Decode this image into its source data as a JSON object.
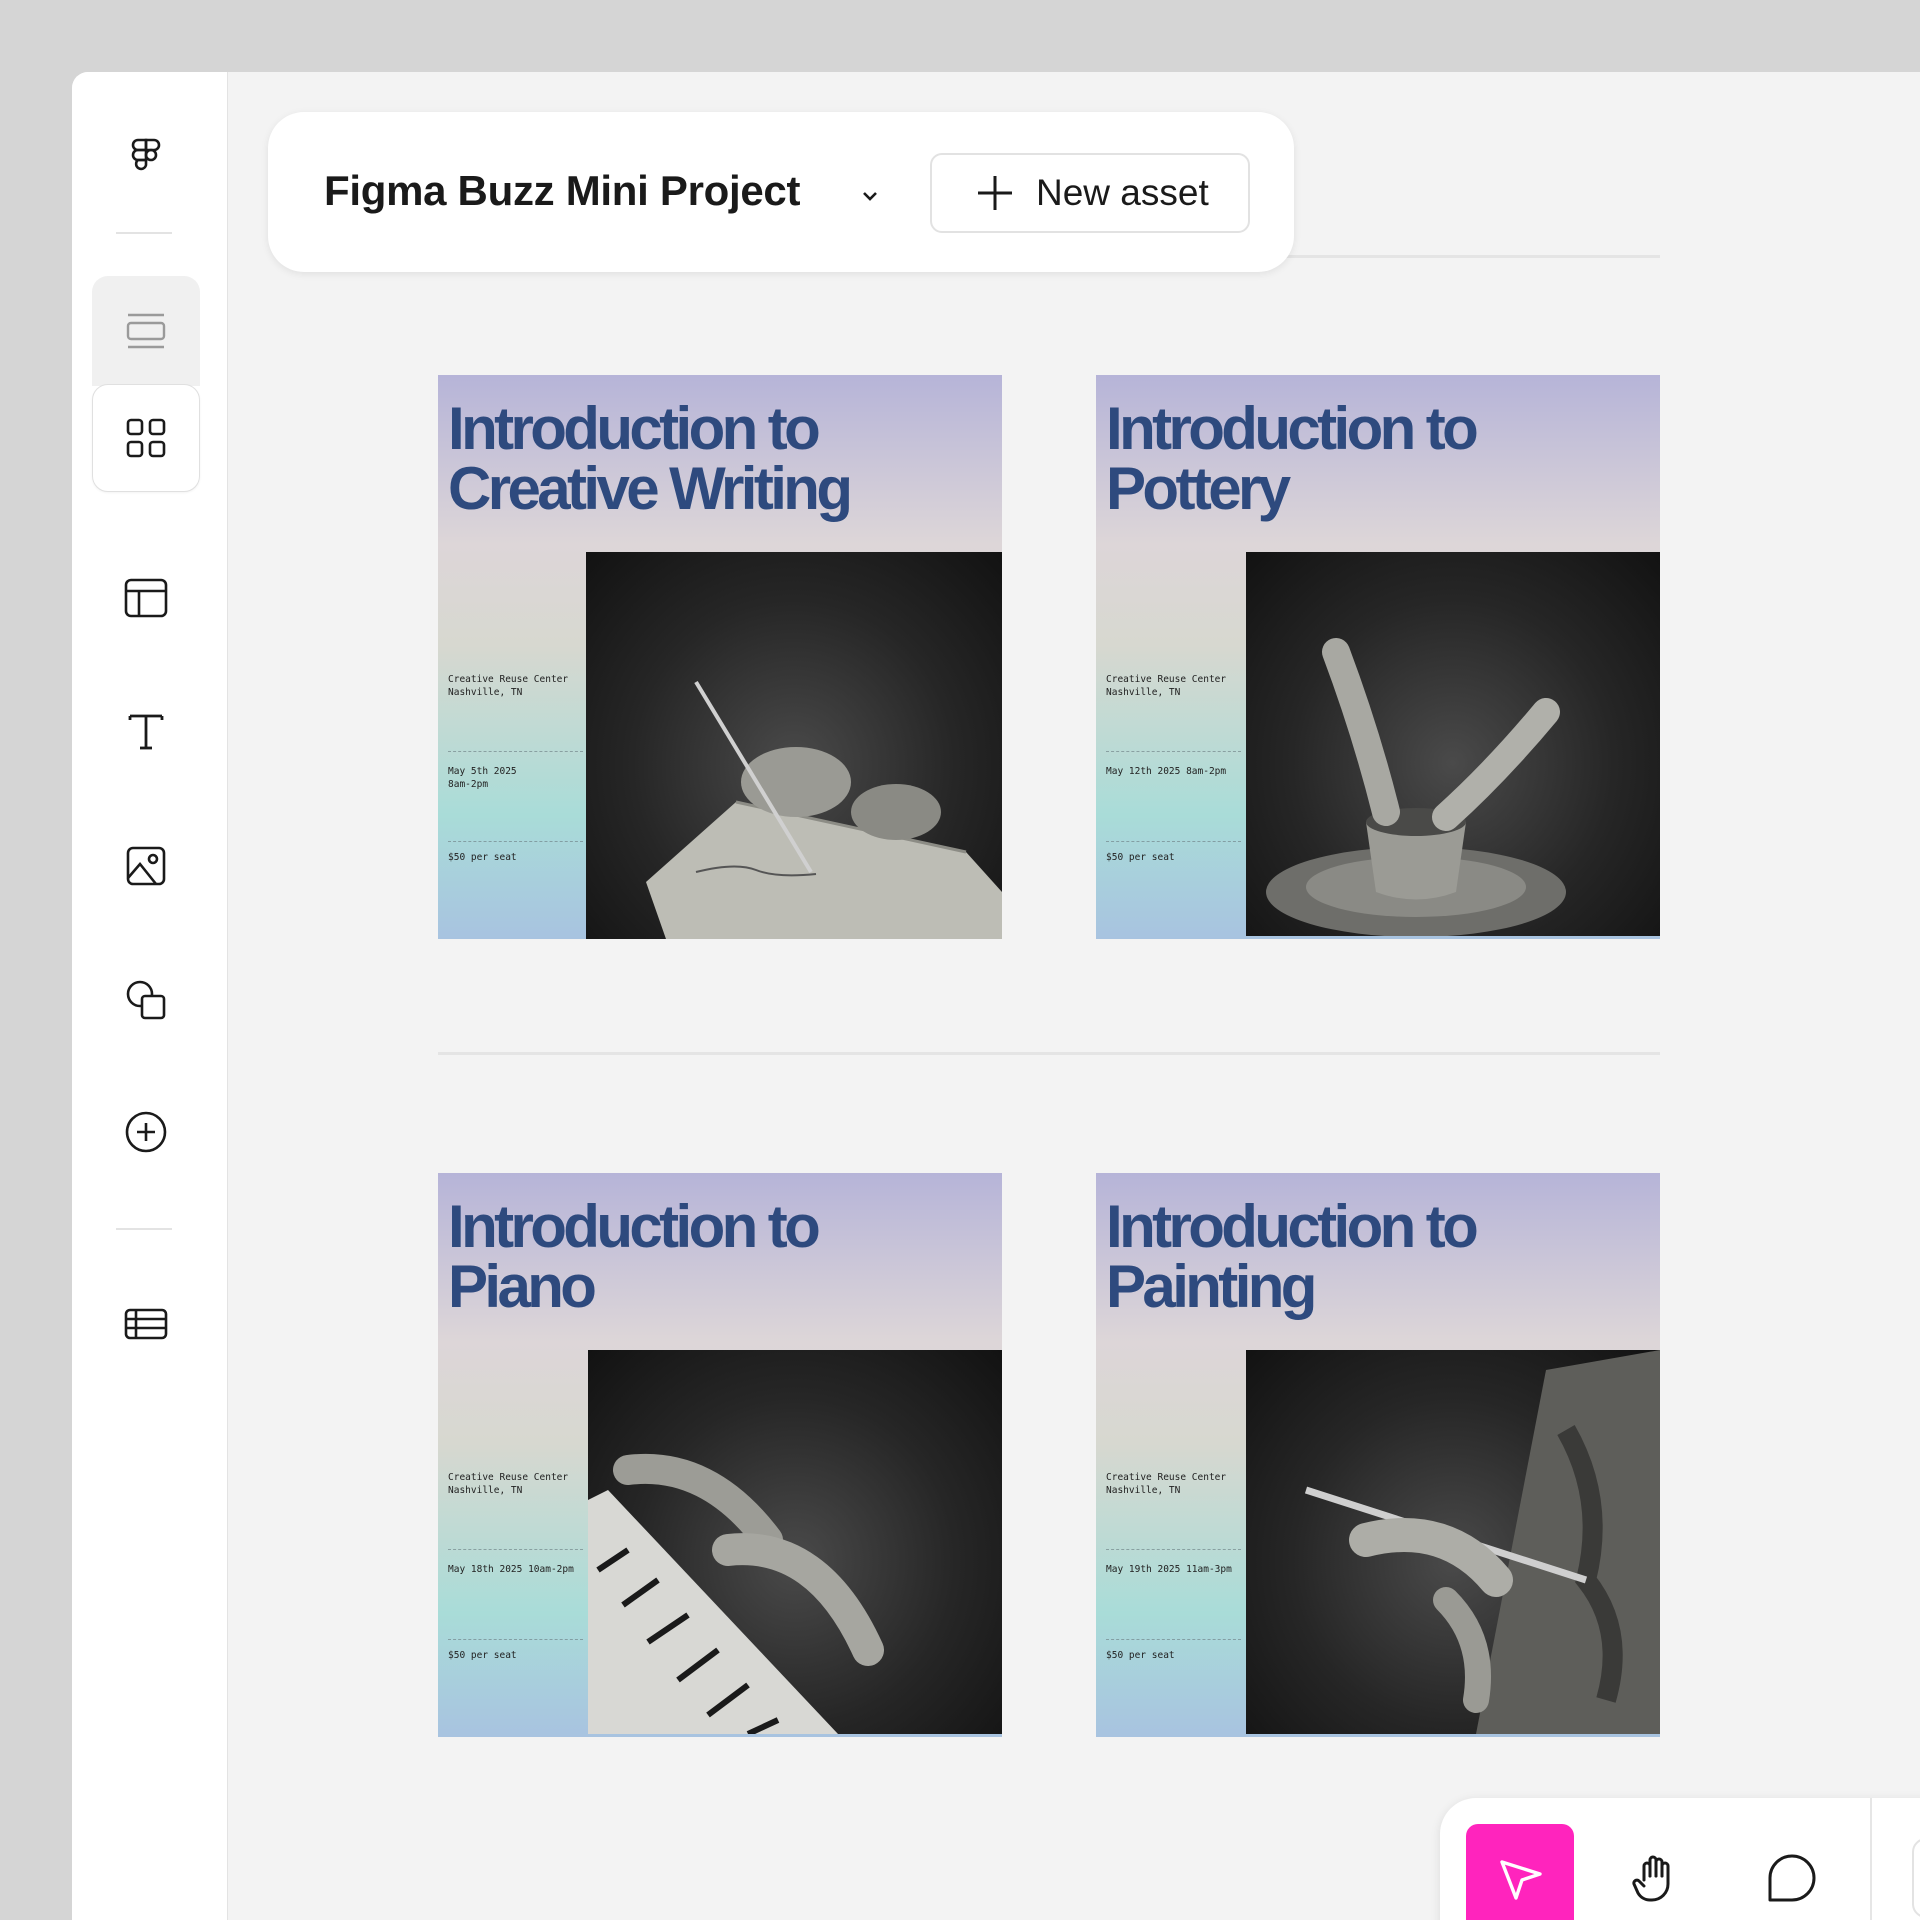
{
  "toolbar_top": {
    "project_title": "Figma Buzz Mini Project",
    "new_asset_label": "New asset"
  },
  "sidebar": {
    "items": [
      {
        "icon": "figma-logo-icon"
      },
      {
        "icon": "single-view-icon"
      },
      {
        "icon": "grid-view-icon"
      },
      {
        "icon": "layout-template-icon"
      },
      {
        "icon": "text-tool-icon"
      },
      {
        "icon": "image-icon"
      },
      {
        "icon": "shapes-icon"
      },
      {
        "icon": "add-circle-icon"
      },
      {
        "icon": "table-icon"
      }
    ]
  },
  "cards": [
    {
      "title": "Introduction to\nCreative Writing",
      "location": "Creative Reuse Center\nNashville, TN",
      "date": "May 5th 2025\n8am-2pm",
      "price": "$50 per seat",
      "photo": "writing"
    },
    {
      "title": "Introduction to\nPottery",
      "location": "Creative Reuse Center\nNashville, TN",
      "date": "May 12th 2025 8am-2pm",
      "price": "$50 per seat",
      "photo": "pottery"
    },
    {
      "title": "Introduction to\nPiano",
      "location": "Creative Reuse Center\nNashville, TN",
      "date": "May 18th 2025 10am-2pm",
      "price": "$50 per seat",
      "photo": "piano"
    },
    {
      "title": "Introduction to\nPainting",
      "location": "Creative Reuse Center\nNashville, TN",
      "date": "May 19th 2025 11am-3pm",
      "price": "$50 per seat",
      "photo": "painting"
    }
  ],
  "bottom_toolbar": {
    "tools": [
      {
        "icon": "cursor-icon",
        "active": true
      },
      {
        "icon": "hand-icon",
        "active": false
      },
      {
        "icon": "comment-icon",
        "active": false
      },
      {
        "icon": "pen-tool-icon",
        "active": false
      }
    ]
  },
  "colors": {
    "accent": "#ff24bd",
    "card_title": "#2e4a7e",
    "canvas_bg": "#f3f3f3"
  }
}
